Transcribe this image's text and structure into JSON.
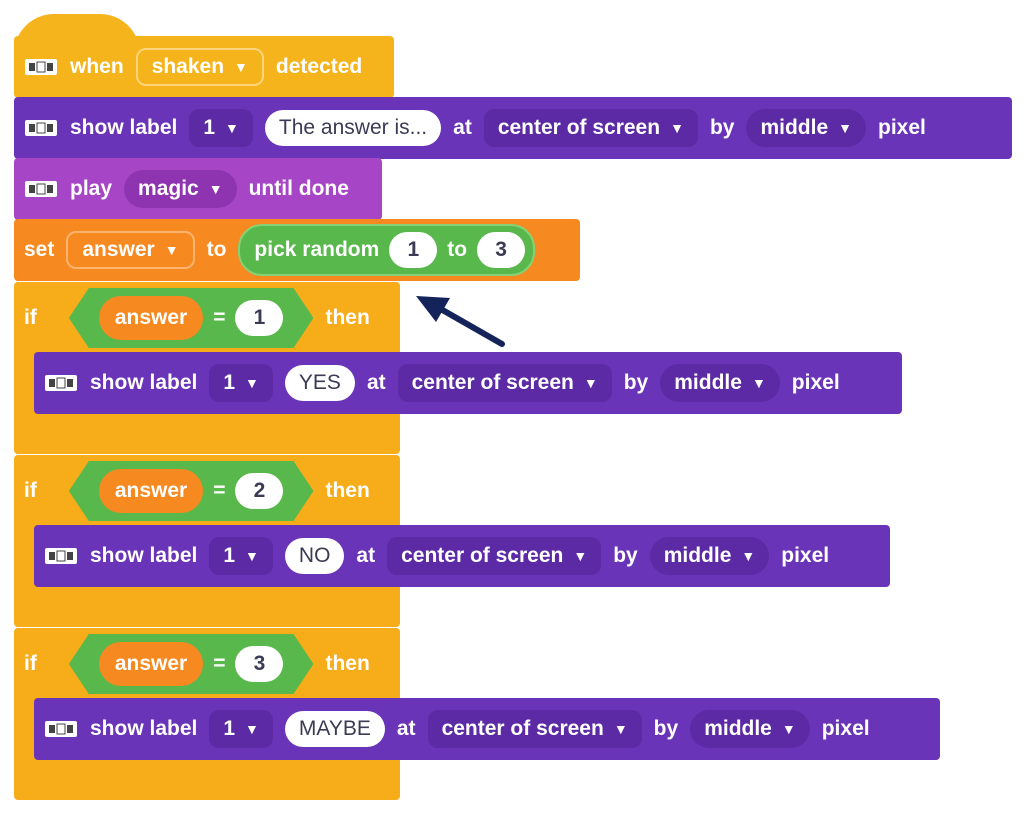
{
  "event": {
    "when": "when",
    "dropdown": "shaken",
    "detected": "detected"
  },
  "show1": {
    "show": "show label",
    "num": "1",
    "text": "The answer is...",
    "at": "at",
    "pos": "center of screen",
    "by": "by",
    "align": "middle",
    "pixel": "pixel"
  },
  "play": {
    "play": "play",
    "sound": "magic",
    "until": "until done"
  },
  "setvar": {
    "set": "set",
    "var": "answer",
    "to": "to",
    "pick": "pick random",
    "from": "1",
    "to2": "to",
    "max": "3"
  },
  "ifs": [
    {
      "if": "if",
      "var": "answer",
      "op": "=",
      "val": "1",
      "then": "then",
      "show": "show label",
      "num": "1",
      "text": "YES",
      "at": "at",
      "pos": "center of screen",
      "by": "by",
      "align": "middle",
      "pixel": "pixel"
    },
    {
      "if": "if",
      "var": "answer",
      "op": "=",
      "val": "2",
      "then": "then",
      "show": "show label",
      "num": "1",
      "text": "NO",
      "at": "at",
      "pos": "center of screen",
      "by": "by",
      "align": "middle",
      "pixel": "pixel"
    },
    {
      "if": "if",
      "var": "answer",
      "op": "=",
      "val": "3",
      "then": "then",
      "show": "show label",
      "num": "1",
      "text": "MAYBE",
      "at": "at",
      "pos": "center of screen",
      "by": "by",
      "align": "middle",
      "pixel": "pixel"
    }
  ],
  "icons": {
    "device": "device-icon",
    "dropdown": "caret-down-icon",
    "pointer": "arrow-pointer-icon"
  },
  "colors": {
    "event": "#f6b41c",
    "looks": "#6a34b8",
    "sound": "#a646c6",
    "variable": "#f6891f",
    "control": "#f7ac1a",
    "operator": "#59b84c"
  }
}
